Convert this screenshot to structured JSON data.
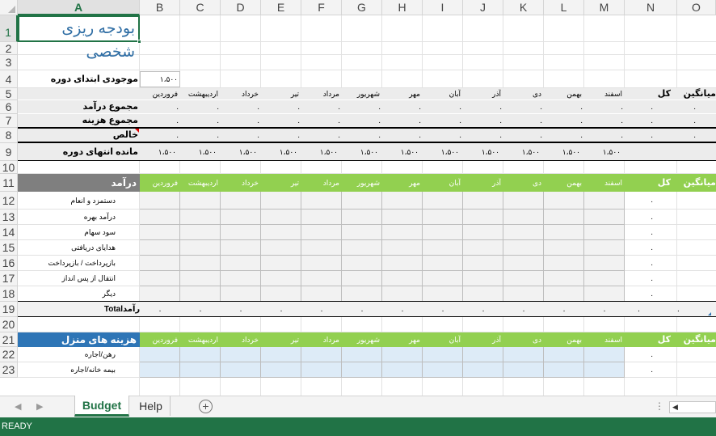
{
  "columns": [
    "A",
    "B",
    "C",
    "D",
    "E",
    "F",
    "G",
    "H",
    "I",
    "J",
    "K",
    "L",
    "M",
    "N",
    "O"
  ],
  "rows": [
    "1",
    "2",
    "3",
    "4",
    "5",
    "6",
    "7",
    "8",
    "9",
    "10",
    "11",
    "12",
    "13",
    "14",
    "15",
    "16",
    "17",
    "18",
    "19",
    "20",
    "21",
    "22",
    "23"
  ],
  "title": "بودجه ریزی شخصی",
  "opening_balance": {
    "label": "موجودی ابتدای دوره",
    "value": "۱،۵۰۰"
  },
  "summary": {
    "months": [
      "فروردین",
      "اردیبهشت",
      "خرداد",
      "تیر",
      "مرداد",
      "شهریور",
      "مهر",
      "آبان",
      "آذر",
      "دی",
      "بهمن",
      "اسفند"
    ],
    "total_label": "کل",
    "avg_label": "میانگین",
    "rows": [
      {
        "label": "مجموع درآمد",
        "value": "."
      },
      {
        "label": "مجموع هزینه",
        "value": "."
      },
      {
        "label": "خالص",
        "value": "."
      }
    ],
    "closing": {
      "label": "مانده انتهای دوره",
      "value": "۱،۵۰۰"
    }
  },
  "income": {
    "header": "درآمد",
    "items": [
      "دستمزد و انعام",
      "درآمد بهره",
      "سود سهام",
      "هدایای دریافتی",
      "بازپرداخت / بازپرداخت",
      "انتقال از پس انداز",
      "دیگر"
    ],
    "item_total": ".",
    "total_label_en": "Total",
    "total_label_fa": "درآمد",
    "total_value": "."
  },
  "housing": {
    "header": "هزینه های منزل",
    "items": [
      "رهن/اجاره",
      "بیمه خانه/اجاره"
    ],
    "item_total": "."
  },
  "colors": {
    "green_header": "#92d050",
    "gray_header": "#7f7f7f",
    "blue_header": "#2e75b6",
    "gray_input": "#f2f2f2",
    "blue_input": "#ddebf7",
    "summary_band": "#ececec",
    "excel_green": "#217346"
  },
  "sheet_tabs": [
    "Budget",
    "Help"
  ],
  "status": "READY"
}
